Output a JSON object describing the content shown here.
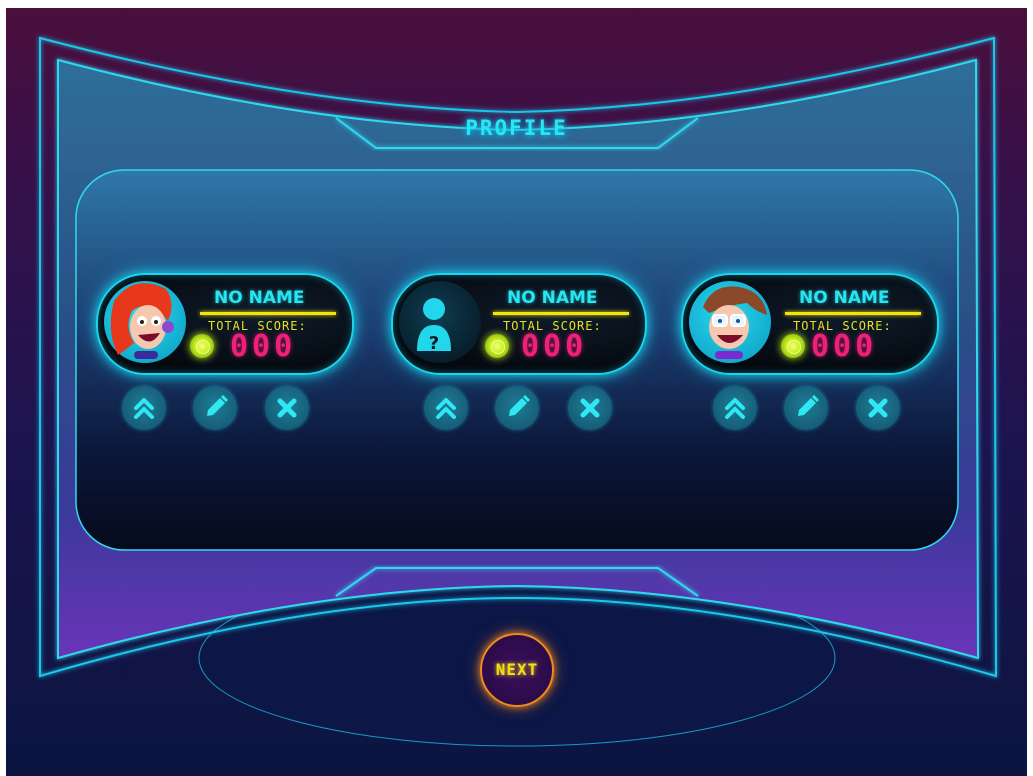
{
  "screen": {
    "title": "PROFILE",
    "next_label": "NEXT"
  },
  "profiles": [
    {
      "name": "NO NAME",
      "score_label": "TOTAL SCORE:",
      "score": "000",
      "avatar": "girl-avatar-icon"
    },
    {
      "name": "NO NAME",
      "score_label": "TOTAL SCORE:",
      "score": "000",
      "avatar": "unknown-user-icon"
    },
    {
      "name": "NO NAME",
      "score_label": "TOTAL SCORE:",
      "score": "000",
      "avatar": "boy-avatar-icon"
    }
  ],
  "actions": [
    "select-icon",
    "edit-pencil-icon",
    "delete-x-icon"
  ],
  "colors": {
    "accent_cyan": "#25e6f3",
    "score_pink": "#f0207a",
    "label_yellow": "#e6e022",
    "next_orange": "#f08a1e"
  }
}
